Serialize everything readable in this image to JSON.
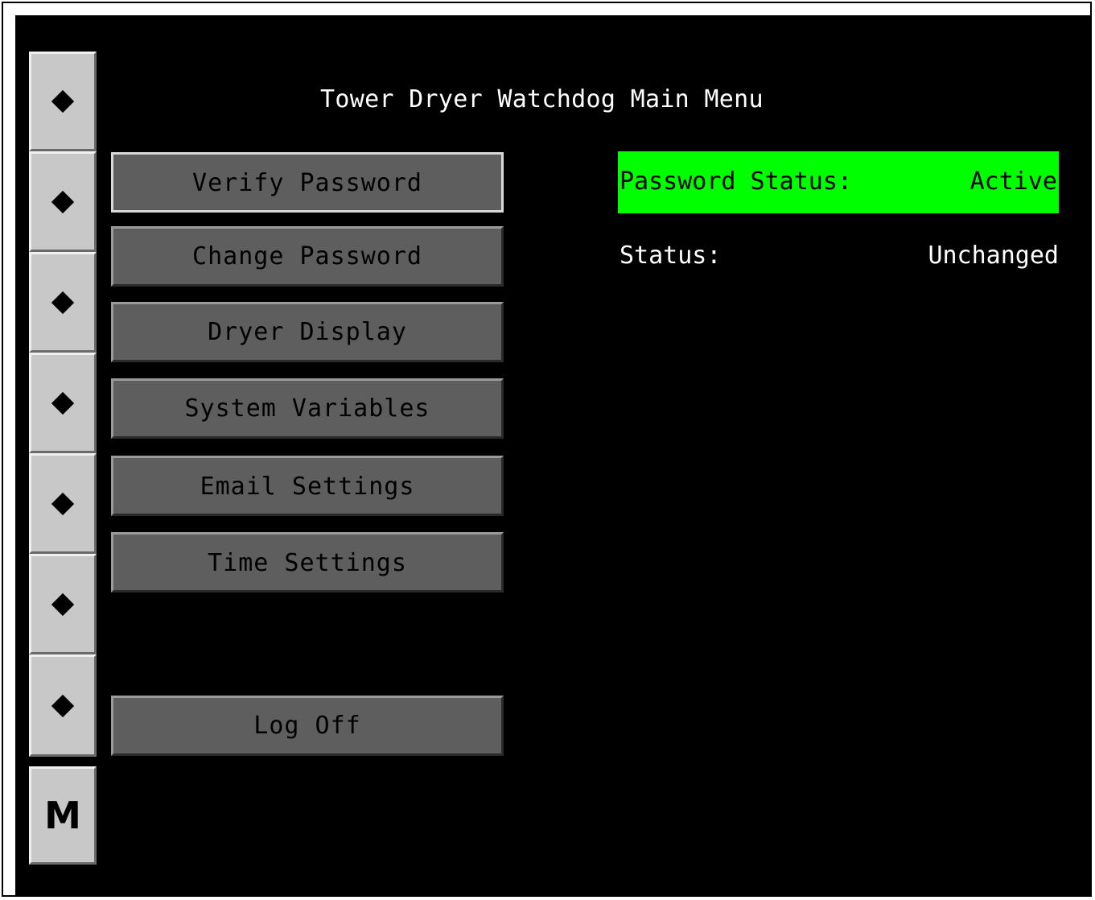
{
  "title": "Tower Dryer Watchdog Main Menu",
  "side_keys": [
    {
      "icon": "diamond-icon"
    },
    {
      "icon": "diamond-icon"
    },
    {
      "icon": "diamond-icon"
    },
    {
      "icon": "diamond-icon"
    },
    {
      "icon": "diamond-icon"
    },
    {
      "icon": "diamond-icon"
    },
    {
      "icon": "diamond-icon"
    },
    {
      "label": "M"
    }
  ],
  "menu": {
    "verify_password": "Verify Password",
    "change_password": "Change Password",
    "dryer_display": "Dryer Display",
    "system_variables": "System Variables",
    "email_settings": "Email Settings",
    "time_settings": "Time Settings",
    "log_off": "Log Off"
  },
  "password_status": {
    "label": "Password Status:",
    "value": "Active",
    "color": "#00ff00"
  },
  "status": {
    "label": "Status:",
    "value": "Unchanged"
  },
  "colors": {
    "screen_bg": "#000000",
    "button_bg": "#5e5e5e",
    "side_key_bg": "#c8c8c8"
  }
}
